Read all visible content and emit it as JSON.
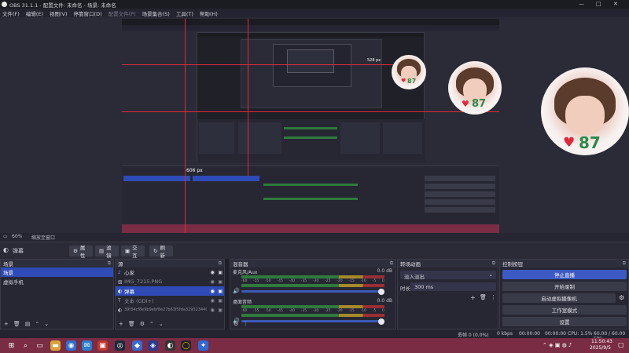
{
  "window": {
    "title": "OBS 31.1.1 - 配置文件: 未命名 - 场景: 未命名",
    "minimize": "—",
    "maximize": "□",
    "close": "✕"
  },
  "menu": {
    "file": "文件(F)",
    "edit": "编辑(E)",
    "view": "视图(V)",
    "dock": "停靠窗口(D)",
    "profile": "配置文件(P)",
    "scene_collection": "场景集合(S)",
    "tools": "工具(T)",
    "help": "帮助(H)"
  },
  "preview": {
    "zoom": "60%",
    "zoom_label": "缩放至窗口",
    "inner_size": "606 px",
    "inner_size2": "528 px",
    "overlay_num_small": "87",
    "overlay_num_med": "87",
    "overlay_num_large": "87"
  },
  "scenebar": {
    "scene_name": "弹幕",
    "props": "属性",
    "filters": "滤镜",
    "interact": "交互",
    "refresh": "刷新"
  },
  "scenes": {
    "title": "场景",
    "items": [
      "场景",
      "虚拟手机"
    ]
  },
  "sources": {
    "title": "源",
    "items": [
      {
        "name": "心家",
        "icon": "audio-icon",
        "dim": false
      },
      {
        "name": "IMG_7215.PNG",
        "icon": "image-icon",
        "dim": true
      },
      {
        "name": "弹幕",
        "icon": "browser-icon",
        "dim": false,
        "sel": true
      },
      {
        "name": "文本 (GDI+)",
        "icon": "text-icon",
        "dim": true
      },
      {
        "name": "39f34cf8e9b9ebf8e27b63f5fda329323440...",
        "icon": "browser-icon",
        "dim": true
      }
    ]
  },
  "mixer": {
    "title": "混音器",
    "channels": [
      {
        "name": "麦克风/Aux",
        "db": "0.0 dB"
      },
      {
        "name": "桌面音频",
        "db": "0.0 dB"
      }
    ],
    "ticks": [
      "-60",
      "-55",
      "-50",
      "-45",
      "-40",
      "-35",
      "-30",
      "-25",
      "-20",
      "-15",
      "-10",
      "-5",
      "0"
    ]
  },
  "transitions": {
    "title": "转场动画",
    "mode": "淡入淡出",
    "duration_label": "时长",
    "duration": "300 ms"
  },
  "controls": {
    "title": "控制按钮",
    "stream": "停止直播",
    "record": "开始录制",
    "virtualcam": "启动虚拟摄像机",
    "studio": "工作室模式",
    "settings": "设置"
  },
  "status": {
    "dropped": "丢帧 0 (0.0%)",
    "kbps": "0 kbps",
    "stream_time": "00:00:00",
    "rec_time": "00:00:00",
    "cpu": "CPU: 1.5%",
    "fps": "60.00 / 60.00 FPS"
  },
  "taskbar": {
    "time": "11:50:43",
    "date": "2025/9/5"
  },
  "colors": {
    "accent": "#2e4bb8",
    "taskbar": "#7a2c44",
    "panel": "#262733"
  }
}
